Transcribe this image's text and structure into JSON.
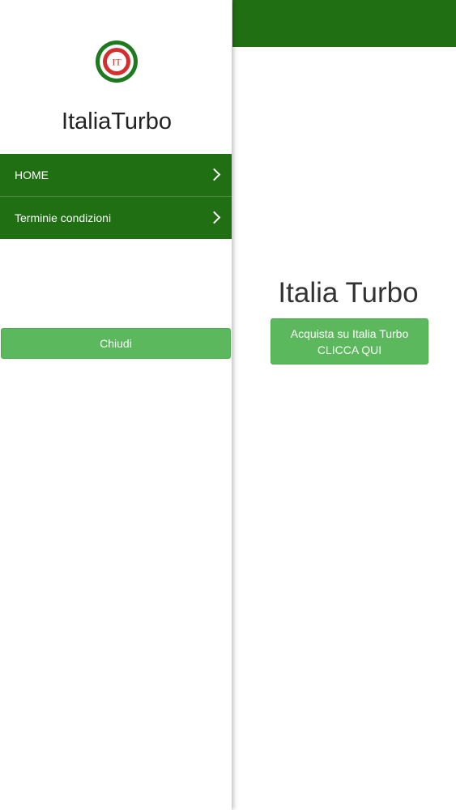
{
  "menu": {
    "brand": "ItaliaTurbo",
    "logo_text": "IT",
    "items": [
      {
        "label": "HOME"
      },
      {
        "label": "Terminie condizioni"
      }
    ],
    "close_label": "Chiudi"
  },
  "main": {
    "title": "Italia Turbo",
    "cta_line1": "Acquista su Italia Turbo",
    "cta_line2": "CLICCA QUI"
  },
  "colors": {
    "header_green": "#216f13",
    "button_green": "#5cb85c",
    "logo_red": "#d32f2f"
  }
}
